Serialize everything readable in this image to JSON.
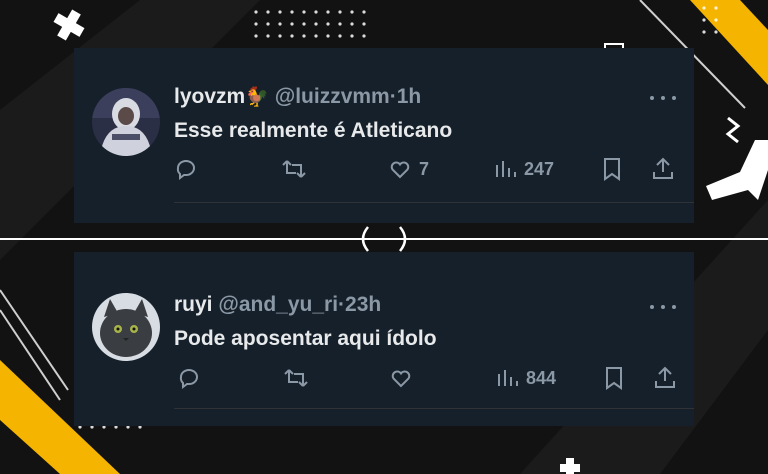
{
  "tweets": [
    {
      "name": "lyovzm",
      "emoji": "🐓",
      "handle": "@luizzvmm",
      "separator": "·",
      "time": "1h",
      "text": "Esse realmente é Atleticano",
      "likes": "7",
      "views": "247",
      "avatar": "avatar-hooded-person"
    },
    {
      "name": "ruyi",
      "handle": "@and_yu_ri",
      "separator": "·",
      "time": "23h",
      "text": "Pode aposentar aqui ídolo",
      "likes": "",
      "views": "844",
      "avatar": "avatar-cat"
    }
  ],
  "icons": [
    "reply-icon",
    "retweet-icon",
    "like-icon",
    "views-icon",
    "bookmark-icon",
    "share-icon",
    "more-icon"
  ],
  "colors": {
    "background": "#121212",
    "card": "#15202b",
    "text": "#e7e9ea",
    "muted": "#8b98a5",
    "accent": "#f5b400"
  }
}
